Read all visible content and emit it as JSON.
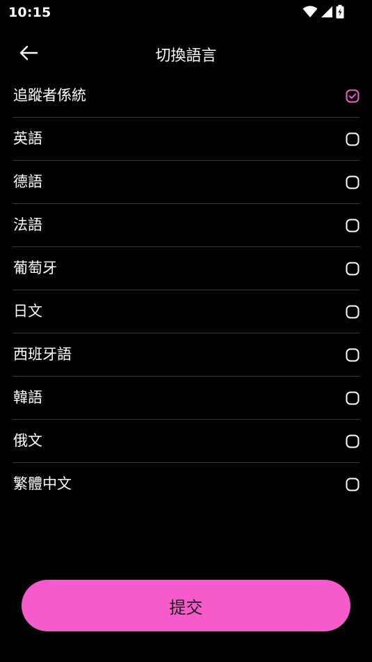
{
  "status_bar": {
    "time": "10:15"
  },
  "header": {
    "title": "切換語言",
    "back_icon": "arrow-left-icon"
  },
  "languages": [
    {
      "label": "追蹤者係統",
      "selected": true
    },
    {
      "label": "英語",
      "selected": false
    },
    {
      "label": "德語",
      "selected": false
    },
    {
      "label": "法語",
      "selected": false
    },
    {
      "label": "葡萄牙",
      "selected": false
    },
    {
      "label": "日文",
      "selected": false
    },
    {
      "label": "西班牙語",
      "selected": false
    },
    {
      "label": "韓語",
      "selected": false
    },
    {
      "label": "俄文",
      "selected": false
    },
    {
      "label": "繁體中文",
      "selected": false
    }
  ],
  "submit": {
    "label": "提交"
  },
  "colors": {
    "accent": "#f55bcb",
    "background": "#000000",
    "divider": "#3a3a3a",
    "text": "#ffffff"
  }
}
